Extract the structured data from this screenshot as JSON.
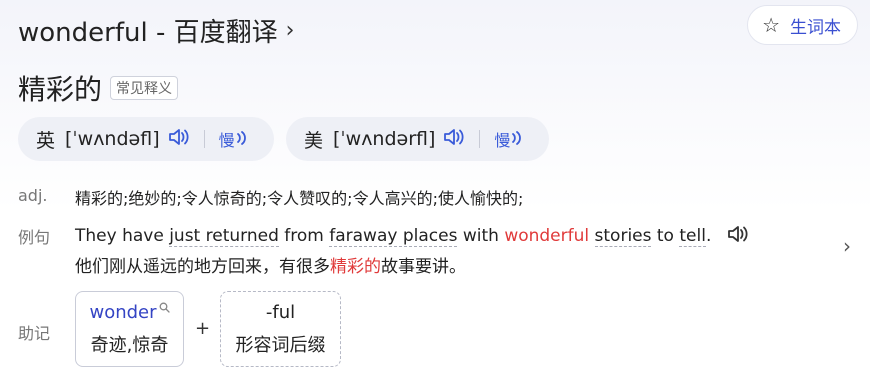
{
  "title": {
    "text": "wonderful - 百度翻译",
    "chevron": "›"
  },
  "vocab_button": {
    "icon": "star-outline-icon",
    "label": "生词本"
  },
  "headword": {
    "text": "精彩的",
    "badge": "常见释义"
  },
  "pronunciations": [
    {
      "region": "英",
      "ipa": "[ˈwʌndəfl]",
      "speaker": "🔊",
      "slow": "慢"
    },
    {
      "region": "美",
      "ipa": "[ˈwʌndərfl]",
      "speaker": "🔊",
      "slow": "慢"
    }
  ],
  "definition": {
    "pos": "adj.",
    "text": "精彩的;绝妙的;令人惊奇的;令人赞叹的;令人高兴的;使人愉快的;"
  },
  "example": {
    "label": "例句",
    "en_parts": [
      "They have ",
      "just returned",
      " from ",
      "faraway places",
      " with ",
      "wonderful",
      " ",
      "stories",
      " to ",
      "tell",
      "."
    ],
    "zh_before": "他们刚从遥远的地方回来，有很多",
    "zh_highlight": "精彩的",
    "zh_after": "故事要讲。",
    "speaker": "🔊",
    "next": "›"
  },
  "mnemonic": {
    "label": "助记",
    "root": {
      "word": "wonder",
      "meaning": "奇迹,惊奇"
    },
    "plus": "+",
    "suffix": {
      "word": "-ful",
      "meaning": "形容词后缀"
    }
  },
  "colors": {
    "accent": "#3a5bd9",
    "highlight": "#e03a3a",
    "link": "#3444c4"
  }
}
